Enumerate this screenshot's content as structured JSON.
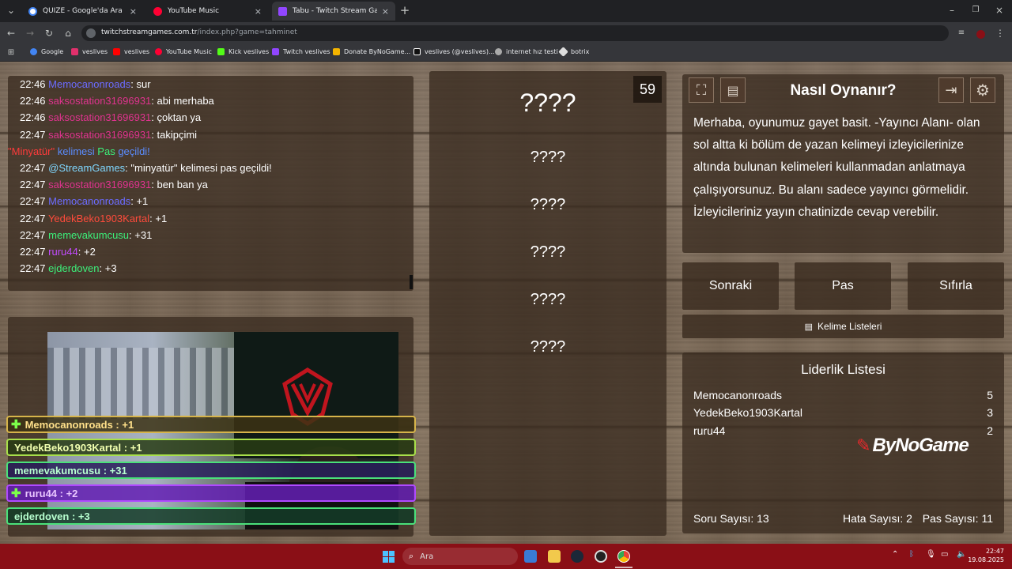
{
  "browser": {
    "tabs": [
      {
        "title": "QUİZE - Google'da Ara",
        "color": "#4285f4"
      },
      {
        "title": "YouTube Music",
        "color": "#ff0033"
      },
      {
        "title": "Tabu - Twitch Stream Game",
        "color": "#9146ff"
      }
    ],
    "url_host": "twitchstreamgames.com.tr",
    "url_path": "/index.php?game=tahminet",
    "bookmarks": [
      {
        "label": "Google",
        "color": "#4285f4"
      },
      {
        "label": "veslives",
        "color": "#e1306c"
      },
      {
        "label": "veslives",
        "color": "#ff0000"
      },
      {
        "label": "YouTube Music",
        "color": "#ff0033"
      },
      {
        "label": "Kick veslives",
        "color": "#53fc18"
      },
      {
        "label": "Twitch veslives",
        "color": "#9146ff"
      },
      {
        "label": "Donate ByNoGame...",
        "color": "#f4b400"
      },
      {
        "label": "veslives (@veslives)...",
        "color": "#ffffff"
      },
      {
        "label": "internet hız testi",
        "color": "#aaaaaa"
      },
      {
        "label": "botrix",
        "color": "#dddddd"
      }
    ]
  },
  "chat": [
    {
      "time": "22:46",
      "user": "Memocanonroads",
      "color": "#6b6bff",
      "msg": ": sur"
    },
    {
      "time": "22:46",
      "user": "saksostation31696931",
      "color": "#e0338f",
      "msg": ": abi merhaba"
    },
    {
      "time": "22:46",
      "user": "saksostation31696931",
      "color": "#e0338f",
      "msg": ": çoktan ya"
    },
    {
      "time": "22:47",
      "user": "saksostation31696931",
      "color": "#e0338f",
      "msg": ": takipçimi"
    },
    {
      "time": "",
      "user": "",
      "color": "#ff3b3b",
      "msg": "",
      "special": true
    },
    {
      "time": "22:47",
      "user": "@StreamGames",
      "color": "#7fd7ff",
      "msg": ": \"minyatür\" kelimesi pas geçildi!"
    },
    {
      "time": "22:47",
      "user": "saksostation31696931",
      "color": "#e0338f",
      "msg": ": ben ban ya"
    },
    {
      "time": "22:47",
      "user": "Memocanonroads",
      "color": "#6b6bff",
      "msg": ": +1"
    },
    {
      "time": "22:47",
      "user": "YedekBeko1903Kartal",
      "color": "#ff4b3b",
      "msg": ": +1"
    },
    {
      "time": "22:47",
      "user": "memevakumcusu",
      "color": "#3cf07a",
      "msg": ": +31"
    },
    {
      "time": "22:47",
      "user": "ruru44",
      "color": "#c34bff",
      "msg": ": +2"
    },
    {
      "time": "22:47",
      "user": "ejderdoven",
      "color": "#3cf07a",
      "msg": ": +3"
    }
  ],
  "system_msg": {
    "word": "\"Minyatür\"",
    "kelimesi": "kelimesi",
    "pas": "Pas",
    "gecildi": "geçildi!"
  },
  "game": {
    "timer": "59",
    "main_word": "????",
    "forbidden": [
      "????",
      "????",
      "????",
      "????",
      "????"
    ]
  },
  "help": {
    "title": "Nasıl Oynanır?",
    "text": "Merhaba, oyunumuz gayet basit. -Yayıncı Alanı- olan sol altta ki bölüm de yazan kelimeyi izleyicilerinize altında bulunan kelimeleri kullanmadan anlatmaya çalışıyorsunuz. Bu alanı sadece yayıncı görmelidir. İzleyicileriniz yayın chatinizde cevap verebilir."
  },
  "controls": {
    "next": "Sonraki",
    "pass": "Pas",
    "reset": "Sıfırla",
    "word_lists": "Kelime Listeleri"
  },
  "leaderboard": {
    "title": "Liderlik Listesi",
    "rows": [
      {
        "name": "Memocanonroads",
        "score": "5"
      },
      {
        "name": "YedekBeko1903Kartal",
        "score": "3"
      },
      {
        "name": "ruru44",
        "score": "2"
      }
    ],
    "brand": "ByNoGame",
    "stats": {
      "questions": "Soru Sayısı: 13",
      "errors": "Hata Sayısı: 2",
      "passes": "Pas Sayısı: 11"
    }
  },
  "overlay_scores": [
    {
      "text": "Memocanonroads : +1",
      "color": "#ffe08a",
      "border": "#d6b44a",
      "bg": "rgba(60,50,20,.85)",
      "icon": true
    },
    {
      "text": "YedekBeko1903Kartal : +1",
      "color": "#f1ffb0",
      "border": "#a8e04a",
      "bg": "rgba(40,60,20,.85)",
      "icon": false
    },
    {
      "text": "memevakumcusu : +31",
      "color": "#b8ffd0",
      "border": "#4ae07a",
      "bg": "rgba(40,30,90,.85)",
      "icon": false
    },
    {
      "text": "ruru44 : +2",
      "color": "#e9c6ff",
      "border": "#b04aff",
      "bg": "rgba(100,30,180,.85)",
      "icon": true
    },
    {
      "text": "ejderdoven : +3",
      "color": "#b8ffd0",
      "border": "#4ae07a",
      "bg": "rgba(20,60,40,.85)",
      "icon": false
    }
  ],
  "taskbar": {
    "search": "Ara",
    "time": "22:47",
    "date": "19.08.2025"
  }
}
